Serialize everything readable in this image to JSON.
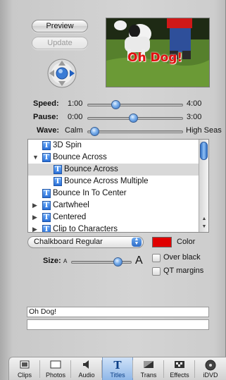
{
  "buttons": {
    "preview": "Preview",
    "update": "Update"
  },
  "preview": {
    "overlay_text": "Oh Dog!"
  },
  "sliders": {
    "speed": {
      "label": "Speed:",
      "min": "1:00",
      "max": "4:00",
      "value_fraction": 0.28
    },
    "pause": {
      "label": "Pause:",
      "min": "0:00",
      "max": "3:00",
      "value_fraction": 0.48
    },
    "wave": {
      "label": "Wave:",
      "min": "Calm",
      "max": "High Seas",
      "value_fraction": 0.03
    }
  },
  "titles_list": {
    "items": [
      {
        "label": "3D Spin",
        "indent": 0,
        "disclosure": "",
        "selected": false
      },
      {
        "label": "Bounce Across",
        "indent": 0,
        "disclosure": "open",
        "selected": false
      },
      {
        "label": "Bounce Across",
        "indent": 1,
        "disclosure": "",
        "selected": true
      },
      {
        "label": "Bounce Across Multiple",
        "indent": 1,
        "disclosure": "",
        "selected": false
      },
      {
        "label": "Bounce In To Center",
        "indent": 0,
        "disclosure": "",
        "selected": false
      },
      {
        "label": "Cartwheel",
        "indent": 0,
        "disclosure": "closed",
        "selected": false
      },
      {
        "label": "Centered",
        "indent": 0,
        "disclosure": "closed",
        "selected": false
      },
      {
        "label": "Clip to Characters",
        "indent": 0,
        "disclosure": "closed",
        "selected": false
      }
    ]
  },
  "font": {
    "selected": "Chalkboard Regular"
  },
  "color": {
    "label": "Color",
    "swatch": "#e00000"
  },
  "size": {
    "label": "Size:",
    "small_glyph": "A",
    "large_glyph": "A",
    "value_fraction": 0.82
  },
  "options": {
    "over_black": "Over black",
    "qt_margins": "QT margins"
  },
  "text_fields": {
    "line1": "Oh Dog!",
    "line2": ""
  },
  "toolbar": {
    "items": [
      {
        "label": "Clips",
        "icon": "clips-icon"
      },
      {
        "label": "Photos",
        "icon": "photos-icon"
      },
      {
        "label": "Audio",
        "icon": "audio-icon"
      },
      {
        "label": "Titles",
        "icon": "titles-icon",
        "active": true
      },
      {
        "label": "Trans",
        "icon": "trans-icon"
      },
      {
        "label": "Effects",
        "icon": "effects-icon"
      },
      {
        "label": "iDVD",
        "icon": "idvd-icon"
      }
    ]
  }
}
